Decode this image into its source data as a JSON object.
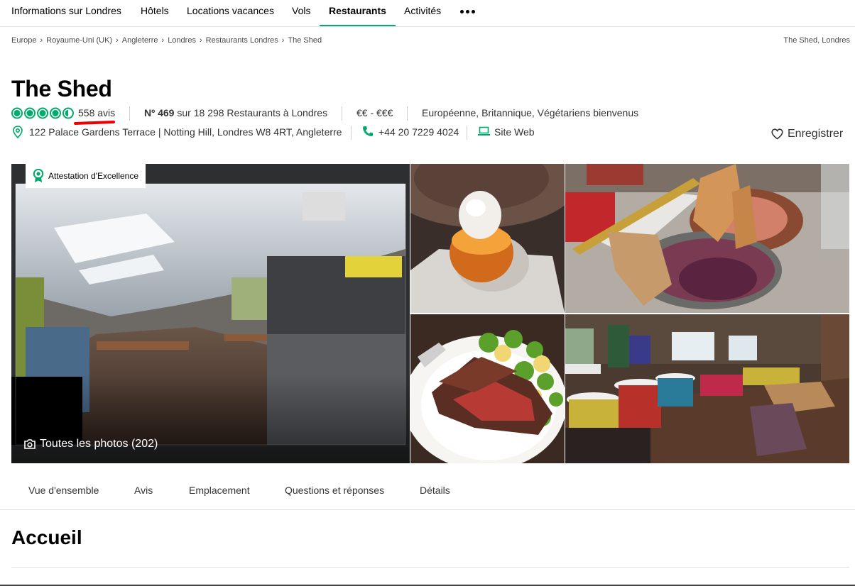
{
  "nav": {
    "items": [
      "Informations sur Londres",
      "Hôtels",
      "Locations vacances",
      "Vols",
      "Restaurants",
      "Activités"
    ],
    "active": "Restaurants",
    "more_icon": "more-dots-icon"
  },
  "breadcrumb": {
    "items": [
      "Europe",
      "Royaume-Uni (UK)",
      "Angleterre",
      "Londres",
      "Restaurants Londres",
      "The Shed"
    ],
    "right": "The Shed, Londres"
  },
  "restaurant": {
    "name": "The Shed",
    "rating": 4.5,
    "rating_max": 5,
    "reviews": "558 avis",
    "rank_prefix": "Nº 469",
    "rank_suffix": " sur 18 298 Restaurants à Londres",
    "price": "€€ - €€€",
    "cuisine": "Européenne, Britannique, Végétariens bienvenus",
    "address": "122 Palace Gardens Terrace | Notting Hill, Londres W8 4RT, Angleterre",
    "phone": "+44 20 7229 4024",
    "website": "Site Web",
    "save": "Enregistrer"
  },
  "gallery": {
    "award": "Attestation d'Excellence",
    "all_photos": "Toutes les photos (202)"
  },
  "tabs": [
    "Vue d'ensemble",
    "Avis",
    "Emplacement",
    "Questions et réponses",
    "Détails"
  ],
  "section": {
    "title": "Accueil"
  },
  "colors": {
    "accent": "#00aa6c",
    "annotation": "#e00000"
  }
}
